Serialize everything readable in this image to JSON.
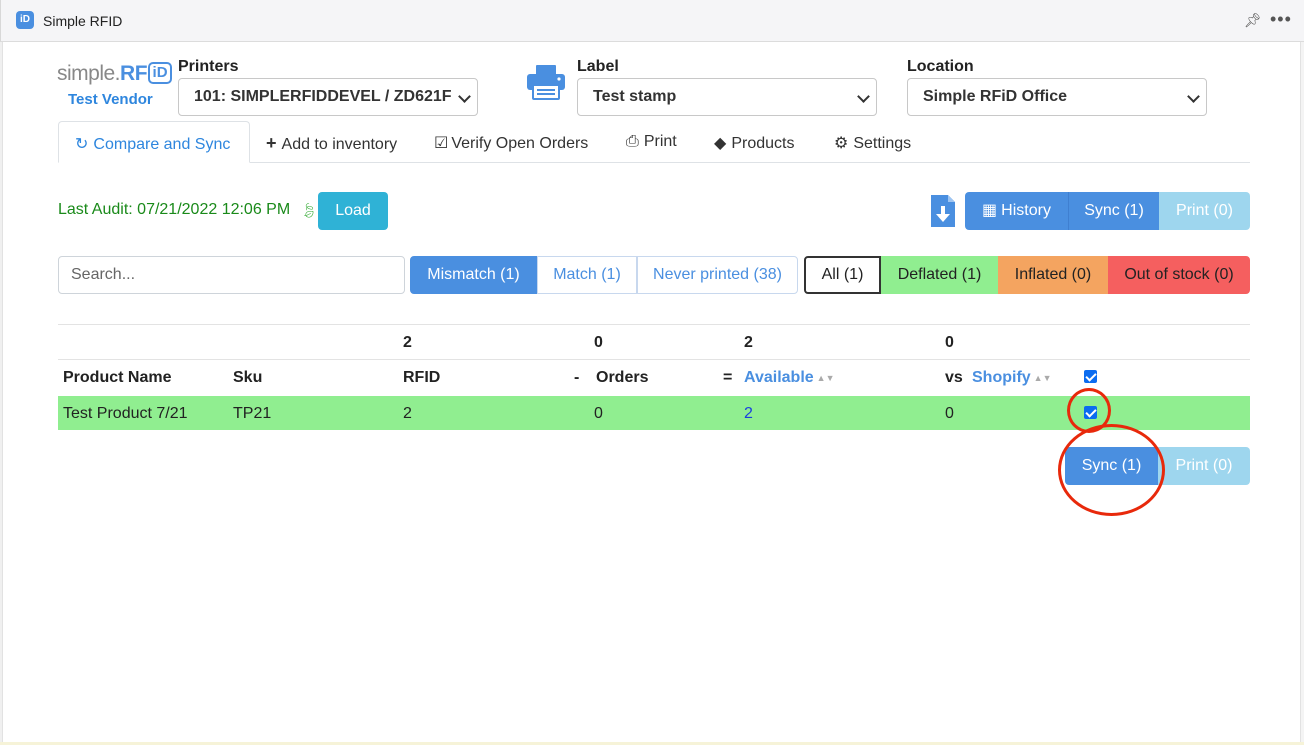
{
  "window": {
    "title": "Simple RFID",
    "pin_icon": "pin-icon",
    "more_icon": "more-icon"
  },
  "logo": {
    "text": "simple.",
    "rf": "RF",
    "id": "iD"
  },
  "vendor": "Test Vendor",
  "printers": {
    "label": "Printers",
    "selected": "101: SIMPLERFIDDEVEL / ZD621F"
  },
  "label": {
    "label": "Label",
    "selected": "Test stamp"
  },
  "location": {
    "label": "Location",
    "selected": "Simple RFiD Office"
  },
  "tabs": [
    {
      "label": "Compare and Sync",
      "icon": "sync-icon",
      "active": true
    },
    {
      "label": "Add to inventory",
      "icon": "plus-icon"
    },
    {
      "label": "Verify Open Orders",
      "icon": "clipboard-check-icon"
    },
    {
      "label": "Print",
      "icon": "printer-icon"
    },
    {
      "label": "Products",
      "icon": "tag-icon"
    },
    {
      "label": "Settings",
      "icon": "gear-icon"
    }
  ],
  "audit": {
    "text": "Last Audit: 07/21/2022 12:06 PM",
    "load_label": "Load"
  },
  "actions": {
    "history": "History",
    "sync": "Sync (1)",
    "print": "Print (0)"
  },
  "search": {
    "placeholder": "Search..."
  },
  "filters": {
    "status": [
      "Mismatch (1)",
      "Match (1)",
      "Never printed (38)"
    ],
    "stock": [
      "All (1)",
      "Deflated (1)",
      "Inflated (0)",
      "Out of stock (0)"
    ]
  },
  "table": {
    "totals": {
      "rfid": "2",
      "orders": "0",
      "available": "2",
      "shopify": "0"
    },
    "headers": {
      "product_name": "Product Name",
      "sku": "Sku",
      "rfid": "RFID",
      "minus": "-",
      "orders": "Orders",
      "equals": "=",
      "available": "Available",
      "vs": "vs",
      "shopify": "Shopify"
    },
    "rows": [
      {
        "product_name": "Test Product 7/21",
        "sku": "TP21",
        "rfid": "2",
        "orders": "0",
        "available": "2",
        "shopify": "0",
        "checked": true
      }
    ]
  },
  "bottom_actions": {
    "sync": "Sync (1)",
    "print": "Print (0)"
  },
  "colors": {
    "accent": "#4a8fe0",
    "info": "#2fb2d6",
    "deflated": "#90ee90",
    "inflated": "#f4a460",
    "out_of_stock": "#f55f5f",
    "annotation": "#e8290b"
  }
}
